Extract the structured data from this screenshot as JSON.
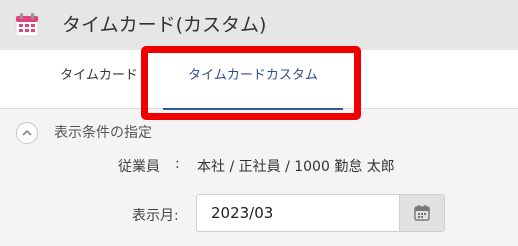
{
  "header": {
    "title": "タイムカード(カスタム)",
    "icon": "calendar-icon",
    "icon_color": "#e0457b"
  },
  "tabs": [
    {
      "label": "タイムカード",
      "active": false
    },
    {
      "label": "タイムカードカスタム",
      "active": true
    }
  ],
  "accent_color": "#2c5aa0",
  "highlight_color": "#ee0000",
  "section": {
    "label": "表示条件の指定",
    "icon": "chevron-up-icon"
  },
  "employee": {
    "label": "従業員",
    "colon": ":",
    "value": "本社 / 正社員 / 1000 勤怠 太郎"
  },
  "month": {
    "label": "表示月:",
    "value": "2023/03",
    "icon": "calendar-icon"
  }
}
